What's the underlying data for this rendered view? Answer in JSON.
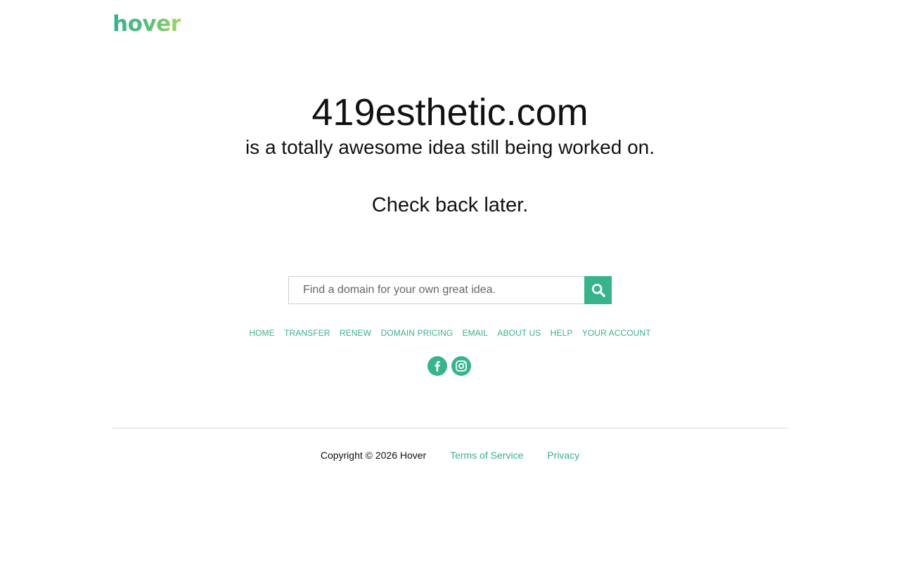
{
  "header": {
    "logo_text": "hover"
  },
  "hero": {
    "domain": "419esthetic.com",
    "tagline": "is a totally awesome idea still being worked on.",
    "check_back": "Check back later."
  },
  "search": {
    "placeholder": "Find a domain for your own great idea.",
    "value": "",
    "button_icon": "search-icon"
  },
  "nav": {
    "items": [
      {
        "label": "HOME"
      },
      {
        "label": "TRANSFER"
      },
      {
        "label": "RENEW"
      },
      {
        "label": "DOMAIN PRICING"
      },
      {
        "label": "EMAIL"
      },
      {
        "label": "ABOUT US"
      },
      {
        "label": "HELP"
      },
      {
        "label": "YOUR ACCOUNT"
      }
    ]
  },
  "social": {
    "icons": [
      "facebook-icon",
      "instagram-icon"
    ]
  },
  "footer": {
    "copyright": "Copyright © 2026 Hover",
    "terms": "Terms of Service",
    "privacy": "Privacy"
  },
  "colors": {
    "accent": "#38b48c",
    "text": "#111111",
    "divider": "#d8d8d8"
  }
}
